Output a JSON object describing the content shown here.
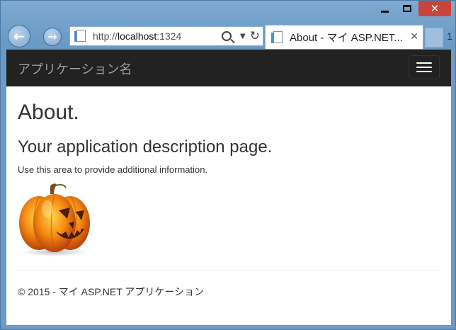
{
  "browser": {
    "url_prefix": "http://",
    "url_host": "localhost",
    "url_port": ":1324",
    "tab_title": "About - マイ ASP.NET...",
    "tab_close_glyph": "✕",
    "right_fragment": "1"
  },
  "site": {
    "brand": "アプリケーション名"
  },
  "page": {
    "title": "About.",
    "subtitle": "Your application description page.",
    "info": "Use this area to provide additional information.",
    "footer": "© 2015 - マイ ASP.NET アプリケーション"
  },
  "icons": {
    "back": "back-arrow-icon",
    "forward": "forward-arrow-icon",
    "search": "search-icon",
    "refresh": "refresh-icon",
    "menu": "hamburger-menu-icon",
    "image": "pumpkin-image"
  },
  "colors": {
    "navbar_bg": "#222222",
    "brand_text": "#9d9d9d",
    "close_button": "#c9443a"
  }
}
